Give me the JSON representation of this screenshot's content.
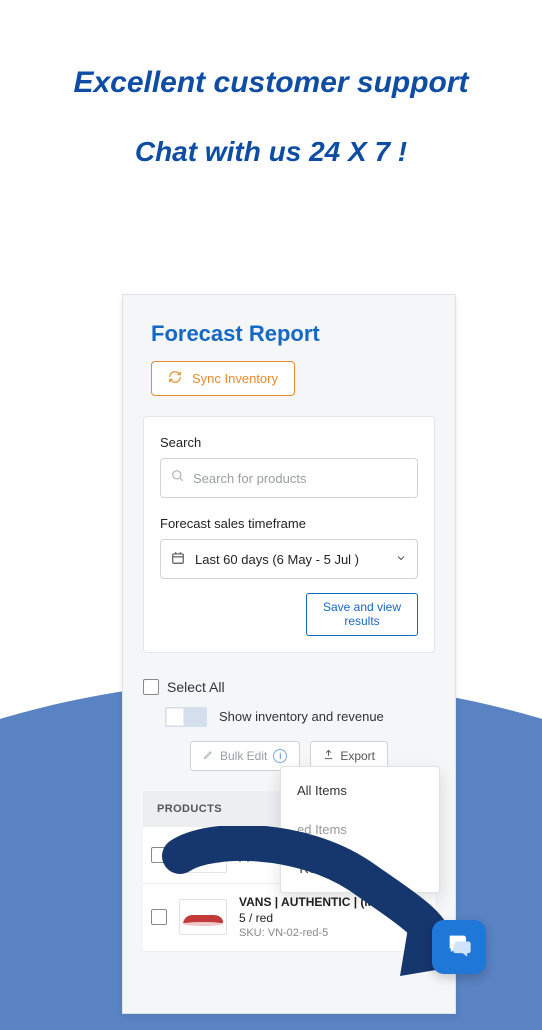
{
  "promo": {
    "headline": "Excellent customer support",
    "subhead": "Chat with us 24 X 7  !"
  },
  "page_title": "Forecast Report",
  "sync_button": "Sync Inventory",
  "search": {
    "label": "Search",
    "placeholder": "Search for products"
  },
  "timeframe": {
    "label": "Forecast sales timeframe",
    "selected": "Last 60 days (6 May - 5 Jul )"
  },
  "save_button": "Save and view results",
  "select_all": "Select All",
  "toggle_label": "Show inventory and revenue",
  "bulk_edit": "Bulk Edit",
  "export": "Export",
  "products_header": "PRODUCTS",
  "dropdown": {
    "item1": "All Items",
    "item2": "ed Items",
    "item3": "'Reorder'"
  },
  "row1": {
    "title_suffix": ") |"
  },
  "row2": {
    "title": "VANS | AUTHENTIC | (M",
    "variant": "5 / red",
    "sku": "SKU: VN-02-red-5"
  }
}
